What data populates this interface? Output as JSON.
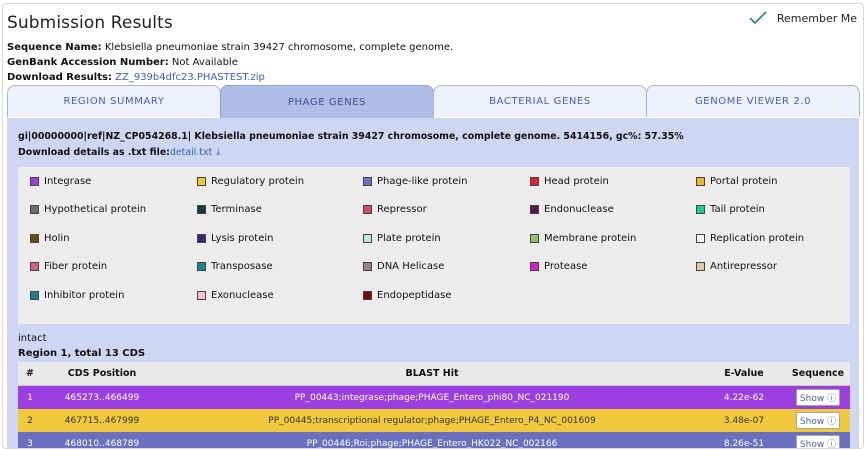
{
  "header": {
    "title": "Submission Results",
    "remember_label": "Remember Me"
  },
  "meta": {
    "sequence_name_label": "Sequence Name:",
    "sequence_name": "Klebsiella pneumoniae strain 39427 chromosome, complete genome.",
    "accession_label": "GenBank Accession Number:",
    "accession": "Not Available",
    "download_label": "Download Results:",
    "download_link": "ZZ_939b4dfc23.PHASTEST.zip"
  },
  "tabs": [
    {
      "label": "REGION SUMMARY",
      "active": false
    },
    {
      "label": "PHAGE GENES",
      "active": true
    },
    {
      "label": "BACTERIAL GENES",
      "active": false
    },
    {
      "label": "GENOME VIEWER 2.0",
      "active": false
    }
  ],
  "panel": {
    "gi_line": "gi|00000000|ref|NZ_CP054268.1| Klebsiella pneumoniae strain 39427 chromosome, complete genome. 5414156, gc%: 57.35%",
    "download_details_label": "Download details as .txt file:",
    "download_details_link": "detail.txt",
    "download_icon": "download-icon",
    "legend": [
      {
        "label": "Integrase",
        "color": "#9b3fe0"
      },
      {
        "label": "Regulatory protein",
        "color": "#f0c83c"
      },
      {
        "label": "Phage-like protein",
        "color": "#6a6fbf"
      },
      {
        "label": "Head protein",
        "color": "#e01f2f"
      },
      {
        "label": "Portal protein",
        "color": "#f2b42a"
      },
      {
        "label": "Hypothetical protein",
        "color": "#6e6e6e"
      },
      {
        "label": "Terminase",
        "color": "#0f3d3d"
      },
      {
        "label": "Repressor",
        "color": "#d64a64"
      },
      {
        "label": "Endonuclease",
        "color": "#5a1450"
      },
      {
        "label": "Tail protein",
        "color": "#14cf95"
      },
      {
        "label": "Holin",
        "color": "#6e4a0a"
      },
      {
        "label": "Lysis protein",
        "color": "#3d2470"
      },
      {
        "label": "Plate protein",
        "color": "#b9e8e3"
      },
      {
        "label": "Membrane protein",
        "color": "#8cc868"
      },
      {
        "label": "Replication protein",
        "color": "#f4f4f4"
      },
      {
        "label": "Fiber protein",
        "color": "#d8606e"
      },
      {
        "label": "Transposase",
        "color": "#15898f"
      },
      {
        "label": "DNA Helicase",
        "color": "#9c7f84"
      },
      {
        "label": "Protease",
        "color": "#d81ec8"
      },
      {
        "label": "Antirepressor",
        "color": "#e5c6a6"
      },
      {
        "label": "Inhibitor protein",
        "color": "#1b7f97"
      },
      {
        "label": "Exonuclease",
        "color": "#f6c4cf"
      },
      {
        "label": "Endopeptidase",
        "color": "#7a0a0a"
      }
    ],
    "status": "intact",
    "region_label": "Region 1, total 13 CDS",
    "table": {
      "headers": [
        "#",
        "CDS Position",
        "BLAST Hit",
        "E-Value",
        "Sequence"
      ],
      "rows": [
        {
          "num": "1",
          "pos": "465273..466499",
          "hit": "PP_00443;integrase;phage;PHAGE_Entero_phi80_NC_021190",
          "evalue": "4.22e-62",
          "seq": "Show",
          "color": "#9b3fe0"
        },
        {
          "num": "2",
          "pos": "467715..467999",
          "hit": "PP_00445;transcriptional regulator;phage;PHAGE_Entero_P4_NC_001609",
          "evalue": "3.48e-07",
          "seq": "Show",
          "color": "#f0c83c"
        },
        {
          "num": "3",
          "pos": "468010..468789",
          "hit": "PP_00446;Roi;phage;PHAGE_Entero_HK022_NC_002166",
          "evalue": "8.26e-51",
          "seq": "Show",
          "color": "#6a6fbf"
        }
      ]
    }
  }
}
